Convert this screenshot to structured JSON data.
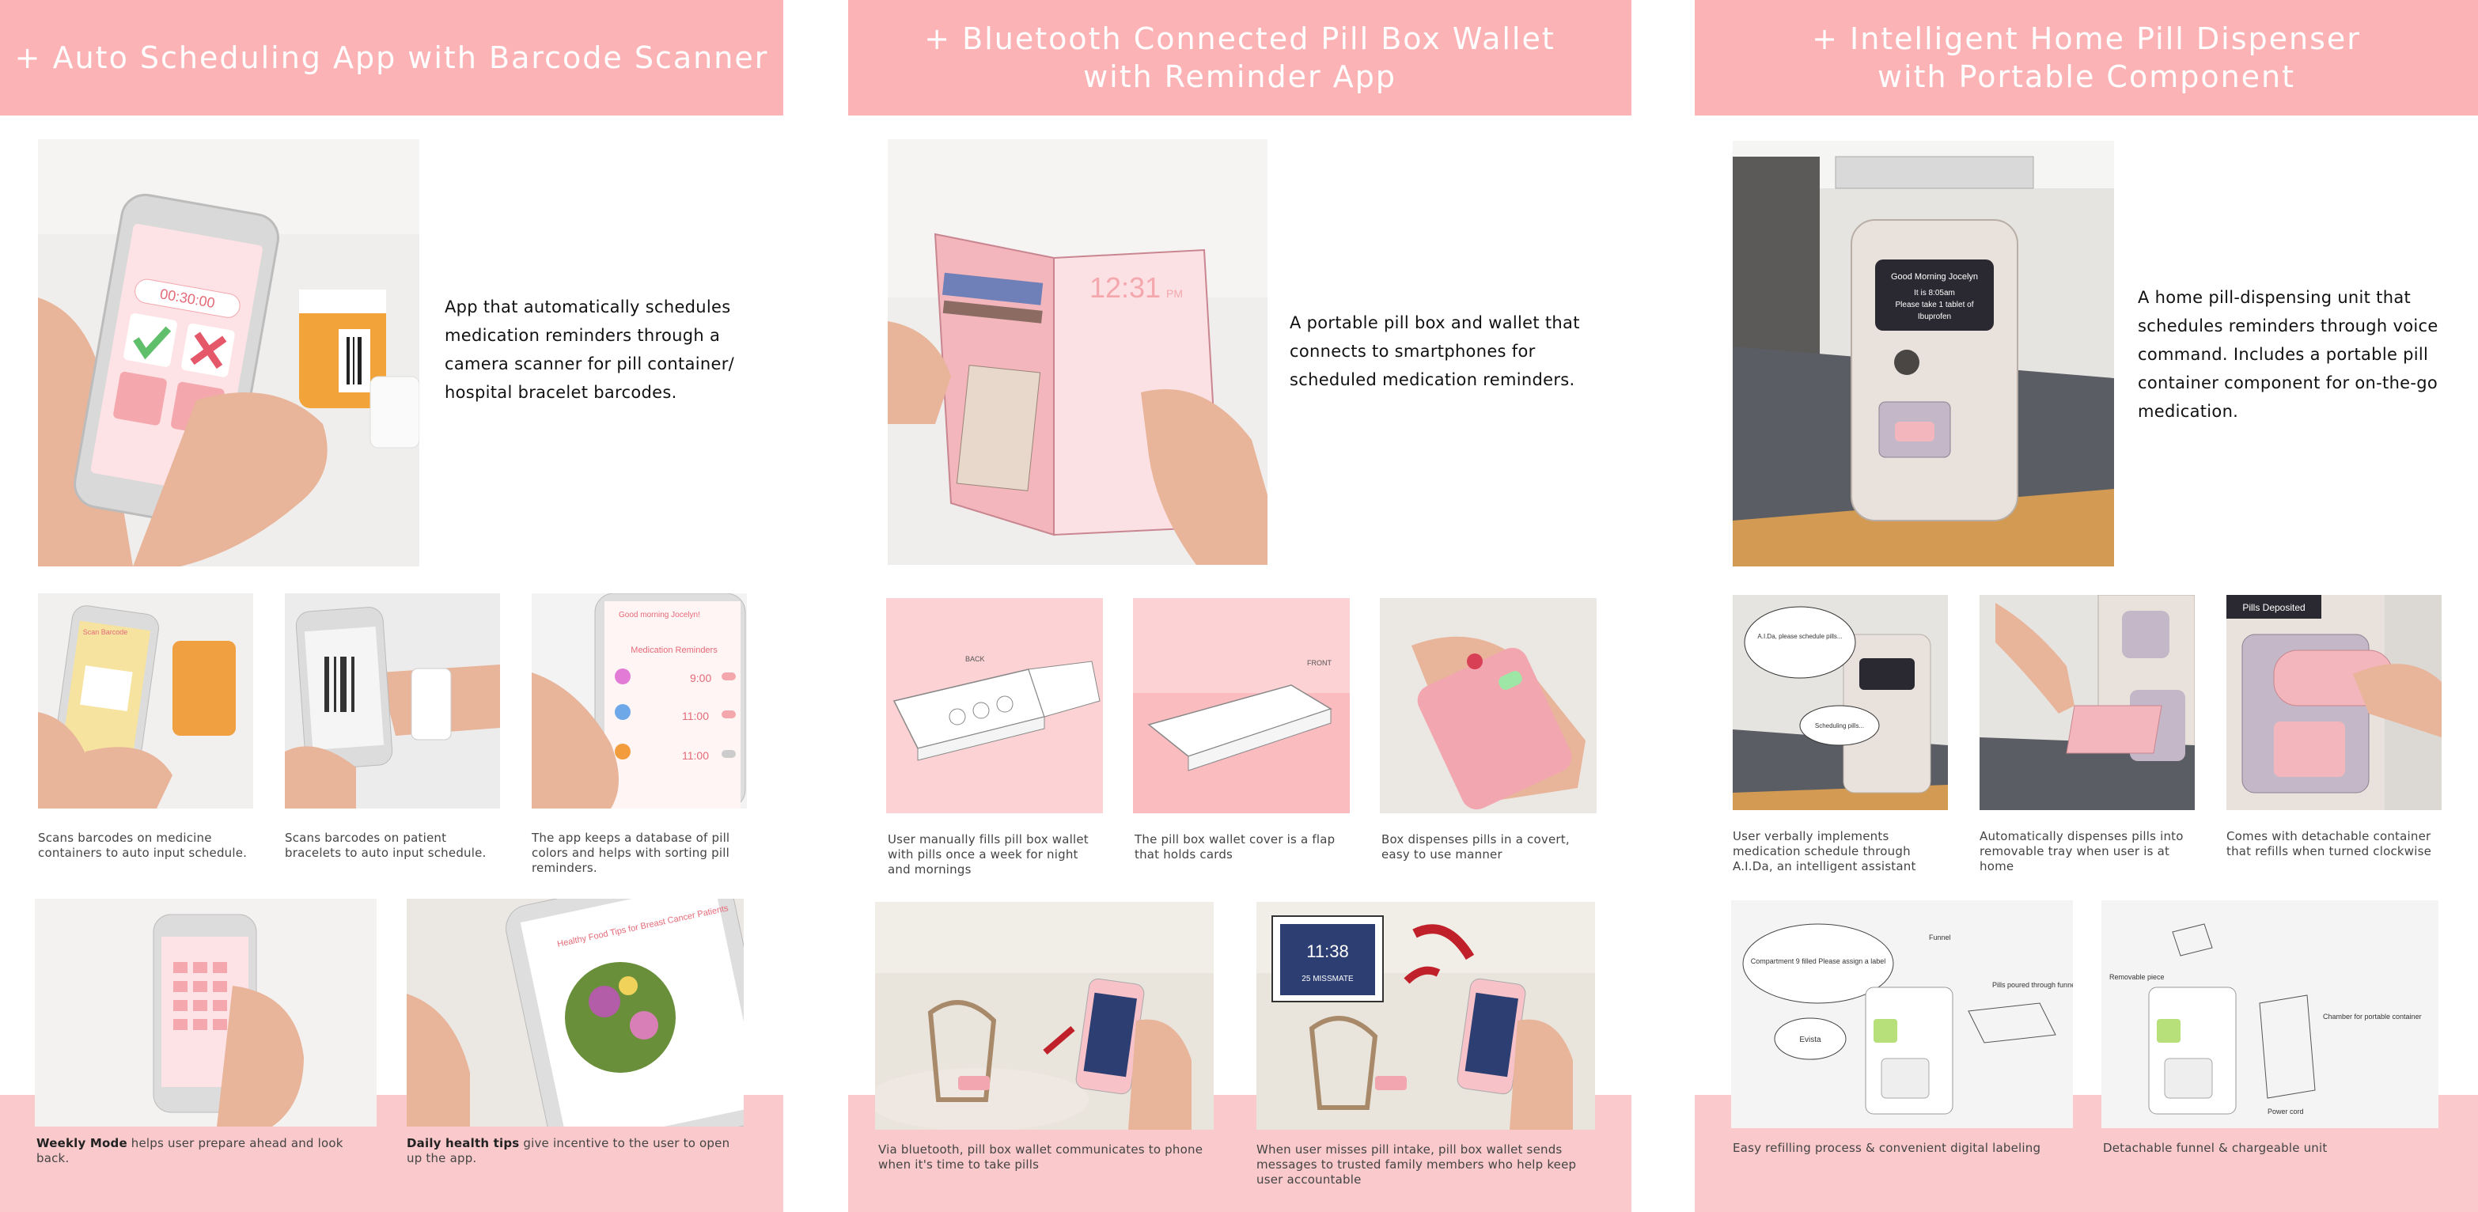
{
  "panels": [
    {
      "title_lines": [
        "+ Auto Scheduling App with Barcode Scanner"
      ],
      "description": "App that automatically schedules medication reminders through a camera scanner for pill container/ hospital bracelet barcodes.",
      "captions": [
        "Scans barcodes on medicine containers to auto input schedule.",
        "Scans barcodes on patient bracelets to auto input schedule.",
        "The app keeps a database of pill colors and helps with sorting pill reminders."
      ],
      "bottom_captions": [
        {
          "bold": "Weekly Mode",
          "text": " helps user prepare ahead and look back."
        },
        {
          "bold": "Daily health tips",
          "text": " give incentive to the user to open up the app."
        }
      ],
      "image_text": {
        "phone_time": "00:30:00",
        "app_greeting": "Good morning Jocelyn!",
        "reminders_title": "Medication Reminders",
        "med1_time": "9:00",
        "med2_time": "11:00",
        "med3_time": "11:00",
        "food_tip": "Healthy Food Tips for Breast Cancer Patients",
        "scan_label": "Scan Barcode"
      }
    },
    {
      "title_lines": [
        "+ Bluetooth Connected Pill Box Wallet",
        "with Reminder App"
      ],
      "description": "A portable pill box and wallet that connects to smartphones for scheduled medication reminders.",
      "captions": [
        "User manually fills pill box wallet with pills once a week for night and mornings",
        "The pill box wallet cover is a flap that holds cards",
        "Box dispenses pills in a covert, easy to use manner"
      ],
      "bottom_captions": [
        {
          "bold": "",
          "text": "Via bluetooth, pill box wallet communicates to phone when it's time to take pills"
        },
        {
          "bold": "",
          "text": "When user misses pill intake, pill box wallet sends messages to trusted family members who help keep user accountable"
        }
      ],
      "image_text": {
        "wallet_time": "12:31",
        "wallet_ampm": "PM",
        "back_label": "BACK",
        "front_label": "FRONT",
        "lock_time": "11:38",
        "missed_msg": "25 MISSMATE"
      }
    },
    {
      "title_lines": [
        "+ Intelligent Home Pill Dispenser",
        "with Portable Component"
      ],
      "description": "A home pill-dispensing unit that schedules reminders through voice command. Includes a portable pill container component for on-the-go medication.",
      "captions": [
        "User verbally implements medication schedule through A.I.Da, an intelligent assistant",
        "Automatically dispenses pills into removable tray when user is at home",
        "Comes with detachable container that refills when turned clockwise"
      ],
      "bottom_captions": [
        {
          "bold": "",
          "text": "Easy refilling process & convenient digital labeling"
        },
        {
          "bold": "",
          "text": "Detachable funnel & chargeable unit"
        }
      ],
      "image_text": {
        "screen_greeting": "Good Morning Jocelyn",
        "screen_line2": "It is 8:05am",
        "screen_line3": "Please take 1 tablet of",
        "screen_line4": "Ibuprofen",
        "pills_deposited": "Pills Deposited",
        "bubble1": "A.I.Da, please schedule pills...",
        "bubble2": "Scheduling pills...",
        "compartment_label": "Compartment 9 filled Please assign a label",
        "bubble_reply": "Evista",
        "sketch_note1": "Pills poured through funnel",
        "sketch_note2": "Funnel",
        "sketch_note3": "Removable piece",
        "sketch_note4": "Power cord",
        "sketch_note5": "Chamber for portable container"
      }
    }
  ],
  "colors": {
    "banner": "#fbb3b6",
    "footer_band": "#f9c9cb",
    "light_pink": "#fcd2d4",
    "accent_pink": "#f4a7ad",
    "text": "#222222"
  }
}
